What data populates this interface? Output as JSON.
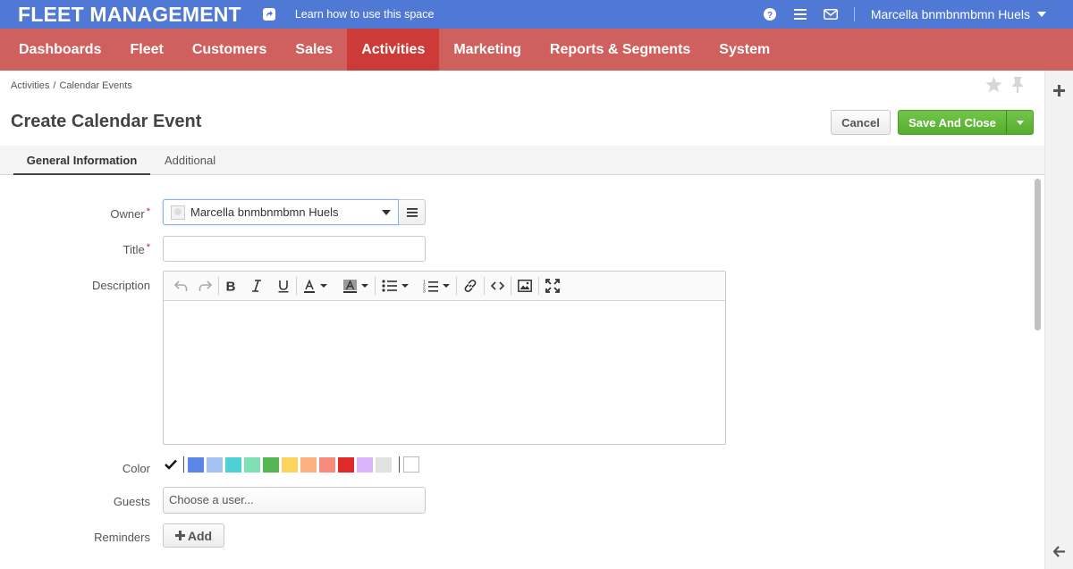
{
  "header": {
    "brand": "FLEET MANAGEMENT",
    "learn_link": "Learn how to use this space",
    "user_name": "Marcella bnmbnmbmn Huels"
  },
  "nav": {
    "items": [
      {
        "label": "Dashboards"
      },
      {
        "label": "Fleet"
      },
      {
        "label": "Customers"
      },
      {
        "label": "Sales"
      },
      {
        "label": "Activities",
        "active": true
      },
      {
        "label": "Marketing"
      },
      {
        "label": "Reports & Segments"
      },
      {
        "label": "System"
      }
    ]
  },
  "breadcrumb": {
    "parts": [
      "Activities",
      "Calendar Events"
    ],
    "separator": "/"
  },
  "page": {
    "title": "Create Calendar Event",
    "cancel_label": "Cancel",
    "save_label": "Save And Close"
  },
  "tabs": [
    {
      "label": "General Information",
      "active": true
    },
    {
      "label": "Additional"
    }
  ],
  "form": {
    "owner": {
      "label": "Owner",
      "required_mark": "*",
      "value": "Marcella bnmbnmbmn Huels"
    },
    "title": {
      "label": "Title",
      "required_mark": "*",
      "value": ""
    },
    "description": {
      "label": "Description",
      "value": ""
    },
    "color": {
      "label": "Color",
      "selected": "none",
      "swatches": [
        "#5b86e5",
        "#a4c2f4",
        "#4dd0d6",
        "#7fe0b6",
        "#55b553",
        "#fdd35c",
        "#feb17f",
        "#f88b7e",
        "#e02929",
        "#dab4fd",
        "#e1e1e1"
      ]
    },
    "guests": {
      "label": "Guests",
      "placeholder": "Choose a user..."
    },
    "reminders": {
      "label": "Reminders",
      "add_label": "Add"
    }
  },
  "colors": {
    "topbar": "#5078d5",
    "nav": "#d0605d",
    "nav_active": "#cc3b38",
    "save_button": "#62b93a"
  }
}
